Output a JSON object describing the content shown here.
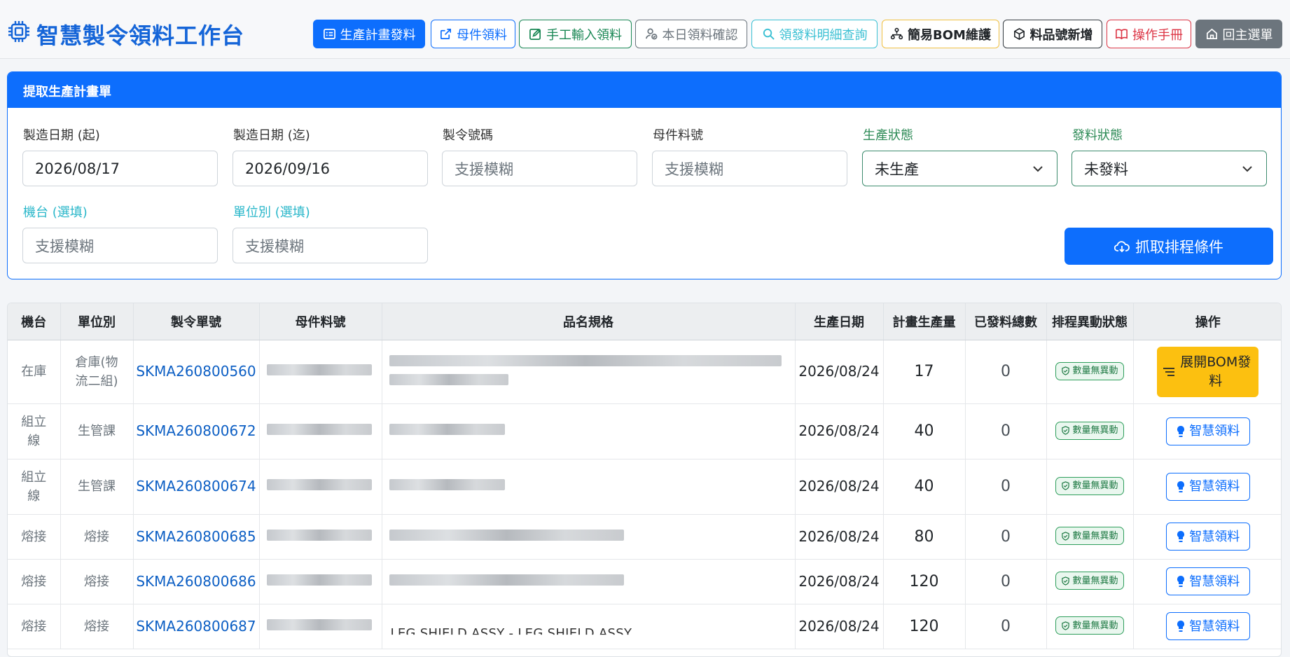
{
  "header": {
    "title": "智慧製令領料工作台",
    "buttons": [
      {
        "label": "生產計畫發料"
      },
      {
        "label": "母件領料"
      },
      {
        "label": "手工輸入領料"
      },
      {
        "label": "本日領料確認"
      },
      {
        "label": "領發料明細查詢"
      },
      {
        "label": "簡易BOM維護"
      },
      {
        "label": "料品號新增"
      },
      {
        "label": "操作手冊"
      },
      {
        "label": "回主選單"
      }
    ]
  },
  "filter": {
    "heading": "提取生產計畫單",
    "date_from_label": "製造日期 (起)",
    "date_from_value": "2026/08/17",
    "date_to_label": "製造日期 (迄)",
    "date_to_value": "2026/09/16",
    "order_no_label": "製令號碼",
    "order_no_placeholder": "支援模糊",
    "parent_part_label": "母件料號",
    "parent_part_placeholder": "支援模糊",
    "prod_status_label": "生產狀態",
    "prod_status_value": "未生產",
    "issue_status_label": "發料狀態",
    "issue_status_value": "未發料",
    "machine_label": "機台 (選填)",
    "machine_placeholder": "支援模糊",
    "unit_label": "單位別 (選填)",
    "unit_placeholder": "支援模糊",
    "fetch_label": "抓取排程條件"
  },
  "table": {
    "headers": [
      "機台",
      "單位別",
      "製令單號",
      "母件料號",
      "品名規格",
      "生產日期",
      "計畫生產量",
      "已發料總數",
      "排程異動狀態",
      "操作"
    ],
    "rows": [
      {
        "machine": "在庫",
        "unit": "倉庫(物流二組)",
        "order": "SKMA260800560",
        "date": "2026/08/24",
        "qty": "17",
        "issued": "0",
        "status": "數量無異動",
        "action": "展開BOM發料"
      },
      {
        "machine": "組立線",
        "unit": "生管課",
        "order": "SKMA260800672",
        "date": "2026/08/24",
        "qty": "40",
        "issued": "0",
        "status": "數量無異動",
        "action": "智慧領料"
      },
      {
        "machine": "組立線",
        "unit": "生管課",
        "order": "SKMA260800674",
        "date": "2026/08/24",
        "qty": "40",
        "issued": "0",
        "status": "數量無異動",
        "action": "智慧領料"
      },
      {
        "machine": "熔接",
        "unit": "熔接",
        "order": "SKMA260800685",
        "date": "2026/08/24",
        "qty": "80",
        "issued": "0",
        "status": "數量無異動",
        "action": "智慧領料"
      },
      {
        "machine": "熔接",
        "unit": "熔接",
        "order": "SKMA260800686",
        "date": "2026/08/24",
        "qty": "120",
        "issued": "0",
        "status": "數量無異動",
        "action": "智慧領料"
      },
      {
        "machine": "熔接",
        "unit": "熔接",
        "order": "SKMA260800687",
        "date": "2026/08/24",
        "qty": "120",
        "issued": "0",
        "status": "數量無異動",
        "action": "智慧領料",
        "spec": "LEG SHIELD ASSY - LEG SHIELD ASSY"
      }
    ]
  },
  "colors": {
    "primary": "#0d6efd",
    "title": "#1565d8",
    "bom_button": "#fcc010",
    "status_green": "#2e9e5b"
  },
  "icons": [
    "chip-icon",
    "list-icon",
    "external-link-icon",
    "edit-icon",
    "user-check-icon",
    "search-icon",
    "diagram-icon",
    "box-icon",
    "book-icon",
    "home-icon",
    "cloud-download-icon",
    "chevron-down-icon",
    "shield-check-icon",
    "lightbulb-icon",
    "lines-icon"
  ]
}
